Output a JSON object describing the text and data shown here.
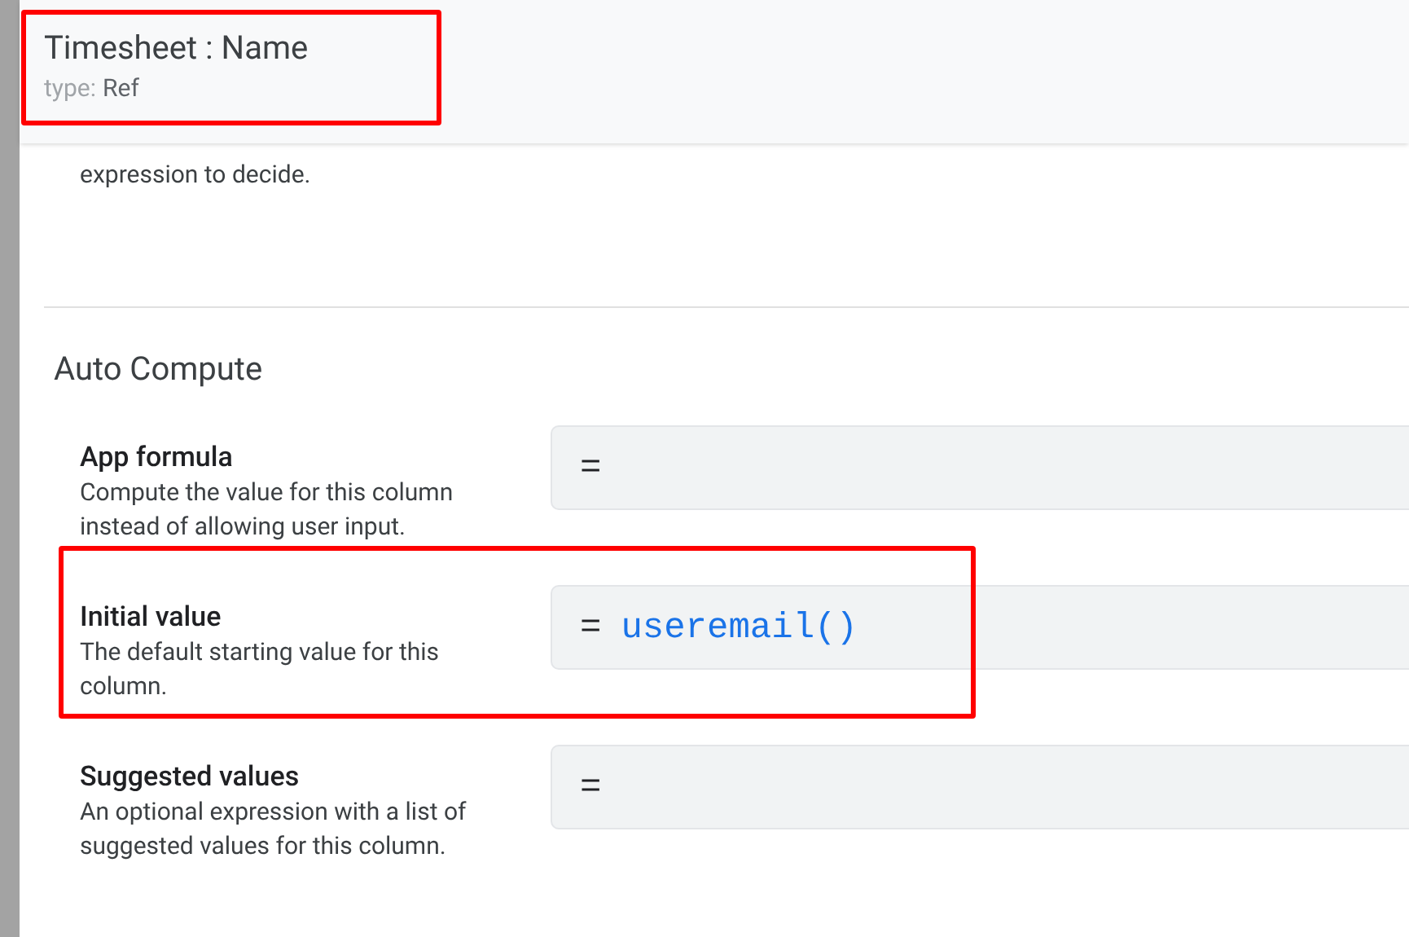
{
  "header": {
    "title": "Timesheet : Name",
    "type_label": "type:",
    "type_value": "Ref",
    "highlighted": true
  },
  "previous_description": [
    "expression to decide."
  ],
  "section": {
    "title": "Auto Compute",
    "rows": [
      {
        "label": "App formula",
        "description": "Compute the value for this column instead of allowing user input.",
        "prefix": "=",
        "formula": "",
        "highlighted": false
      },
      {
        "label": "Initial value",
        "description": "The default starting value for this column.",
        "prefix": "=",
        "formula": "useremail()",
        "highlighted": true
      },
      {
        "label": "Suggested values",
        "description": "An optional expression with a list of suggested values for this column.",
        "prefix": "=",
        "formula": "",
        "highlighted": false
      }
    ]
  }
}
